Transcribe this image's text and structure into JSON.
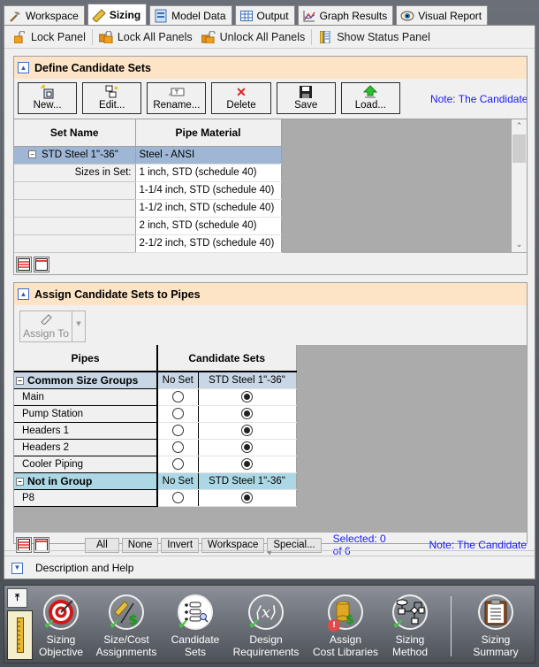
{
  "tabs": [
    {
      "label": "Workspace",
      "icon": "workspace-icon",
      "active": false
    },
    {
      "label": "Sizing",
      "icon": "ruler-icon",
      "active": true
    },
    {
      "label": "Model Data",
      "icon": "model-data-icon",
      "active": false
    },
    {
      "label": "Output",
      "icon": "output-table-icon",
      "active": false
    },
    {
      "label": "Graph Results",
      "icon": "graph-icon",
      "active": false
    },
    {
      "label": "Visual Report",
      "icon": "eye-icon",
      "active": false
    }
  ],
  "toolbar": {
    "lock_panel": "Lock Panel",
    "lock_all": "Lock All Panels",
    "unlock_all": "Unlock All Panels",
    "show_status": "Show Status Panel"
  },
  "define_panel": {
    "title": "Define Candidate Sets",
    "buttons": {
      "new": "New...",
      "edit": "Edit...",
      "rename": "Rename...",
      "delete": "Delete",
      "save": "Save",
      "load": "Load..."
    },
    "note": "Note: The Candidate",
    "columns": [
      "Set Name",
      "Pipe Material"
    ],
    "set_name": "STD Steel 1\"-36\"",
    "pipe_material": "Steel - ANSI",
    "sizes_label": "Sizes in Set:",
    "sizes": [
      "1 inch, STD (schedule 40)",
      "1-1/4 inch, STD (schedule 40)",
      "1-1/2 inch, STD (schedule 40)",
      "2 inch, STD (schedule 40)",
      "2-1/2 inch, STD (schedule 40)"
    ]
  },
  "assign_panel": {
    "title": "Assign Candidate Sets to Pipes",
    "assign_to": "Assign To",
    "columns": {
      "pipes": "Pipes",
      "candidate_sets": "Candidate Sets"
    },
    "groups": [
      {
        "name": "Common Size Groups",
        "sub_cols": [
          "No Set",
          "STD Steel 1\"-36\""
        ],
        "rows": [
          {
            "name": "Main",
            "selected": "STD Steel 1\"-36\""
          },
          {
            "name": "Pump Station",
            "selected": "STD Steel 1\"-36\""
          },
          {
            "name": "Headers 1",
            "selected": "STD Steel 1\"-36\""
          },
          {
            "name": "Headers 2",
            "selected": "STD Steel 1\"-36\""
          },
          {
            "name": "Cooler Piping",
            "selected": "STD Steel 1\"-36\""
          }
        ]
      },
      {
        "name": "Not in Group",
        "sub_cols": [
          "No Set",
          "STD Steel 1\"-36\""
        ],
        "rows": [
          {
            "name": "P8",
            "selected": "STD Steel 1\"-36\""
          }
        ]
      }
    ],
    "select_buttons": [
      "All",
      "None",
      "Invert",
      "Workspace",
      "Special..."
    ],
    "selected_count": "Selected: 0 of 6",
    "note": "Note: The Candidate"
  },
  "description_bar": "Description and Help",
  "ribbon": [
    {
      "label1": "Sizing",
      "label2": "Objective",
      "status": "complete"
    },
    {
      "label1": "Size/Cost",
      "label2": "Assignments",
      "status": "complete"
    },
    {
      "label1": "Candidate",
      "label2": "Sets",
      "status": "complete"
    },
    {
      "label1": "Design",
      "label2": "Requirements",
      "status": "complete"
    },
    {
      "label1": "Assign",
      "label2": "Cost Libraries",
      "status": "warning"
    },
    {
      "label1": "Sizing",
      "label2": "Method",
      "status": "complete"
    },
    {
      "label1": "Sizing",
      "label2": "Summary",
      "status": "none"
    }
  ]
}
